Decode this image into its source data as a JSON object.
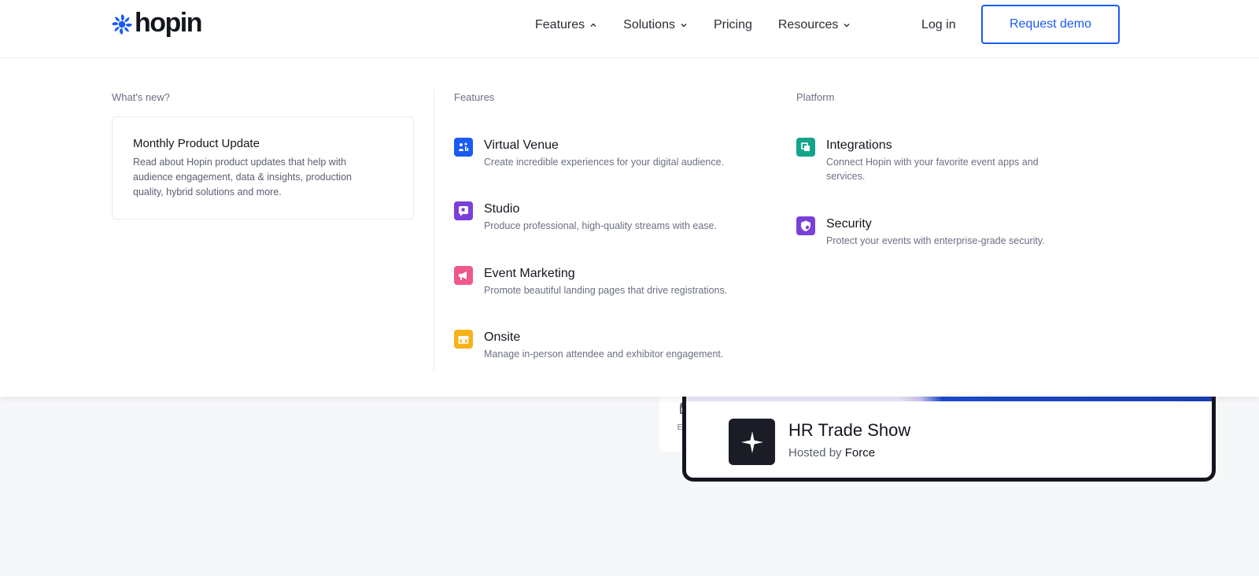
{
  "brand": {
    "name": "hopin",
    "color": "#1a5af5"
  },
  "nav": {
    "items": [
      {
        "label": "Features",
        "icon": "chevron-up-icon"
      },
      {
        "label": "Solutions",
        "icon": "chevron-down-icon"
      },
      {
        "label": "Pricing"
      },
      {
        "label": "Resources",
        "icon": "chevron-down-icon"
      }
    ],
    "login": "Log in",
    "demo": "Request demo"
  },
  "menu": {
    "whats_new": {
      "title": "What's new?",
      "card_title": "Monthly Product Update",
      "card_desc": "Read about Hopin product updates that help with audience engagement, data & insights, production quality, hybrid solutions and more."
    },
    "features": {
      "title": "Features",
      "items": [
        {
          "title": "Virtual Venue",
          "desc": "Create incredible experiences for your digital audience.",
          "icon": "venue-icon",
          "color": "#1a5af5"
        },
        {
          "title": "Studio",
          "desc": "Produce professional, high-quality streams with ease.",
          "icon": "studio-icon",
          "color": "#7b3fd9"
        },
        {
          "title": "Event Marketing",
          "desc": "Promote beautiful landing pages that drive registrations.",
          "icon": "megaphone-icon",
          "color": "#f0578a"
        },
        {
          "title": "Onsite",
          "desc": "Manage in-person attendee and exhibitor engagement.",
          "icon": "onsite-icon",
          "color": "#f6b219"
        }
      ]
    },
    "platform": {
      "title": "Platform",
      "items": [
        {
          "title": "Integrations",
          "desc": "Connect Hopin with your favorite event apps and services.",
          "icon": "integrations-icon",
          "color": "#14a38b"
        },
        {
          "title": "Security",
          "desc": "Protect your events with enterprise-grade security.",
          "icon": "shield-icon",
          "color": "#7b3fd9"
        }
      ]
    }
  },
  "event_card": {
    "title": "HR Trade Show",
    "hosted_prefix": "Hosted by",
    "host": "Force",
    "expo_label": "Expo"
  }
}
